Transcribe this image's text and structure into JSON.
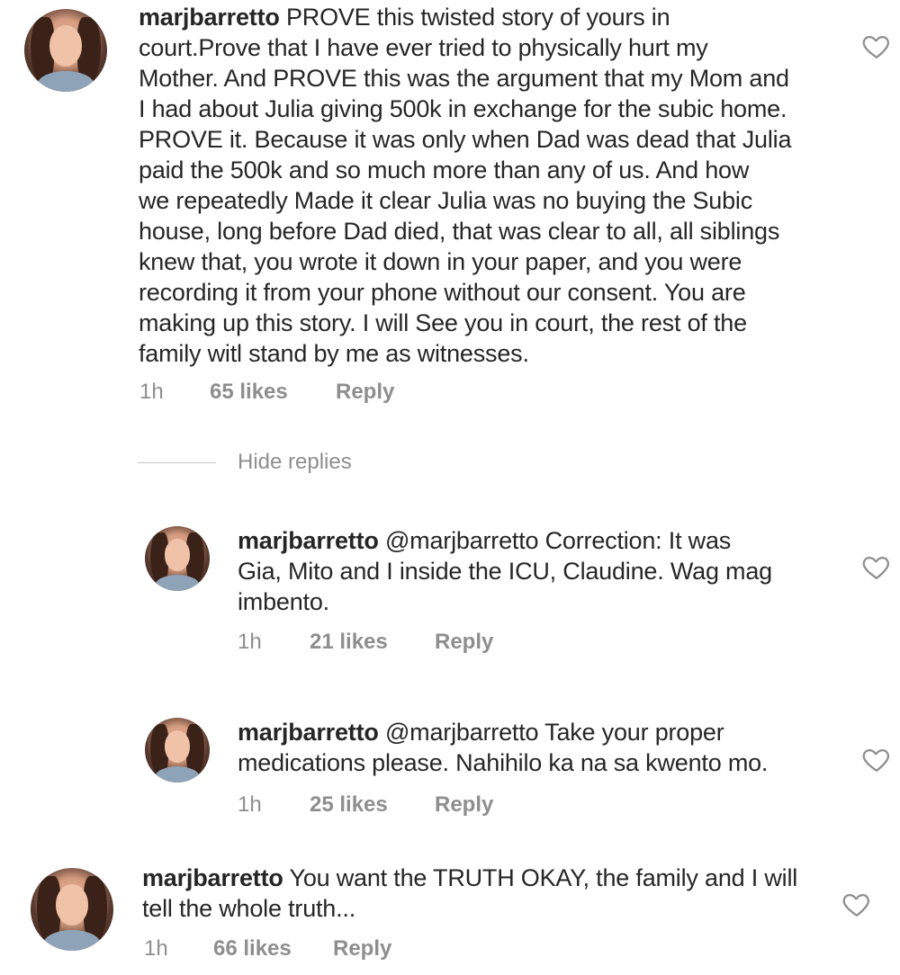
{
  "comments": [
    {
      "username": "marjbarretto",
      "lines": [
        "PROVE this twisted story of yours in",
        "court.Prove that I have ever tried to physically hurt my",
        "Mother. And PROVE this was the argument that my Mom and",
        "I had about Julia giving 500k in exchange for the subic home.",
        "PROVE it. Because it was only when Dad was dead that Julia",
        "paid the 500k and so much more than any of us. And how",
        "we repeatedly Made it clear Julia was no buying the Subic",
        "house, long before Dad died, that was clear to all, all siblings",
        "knew that, you wrote it down in your paper, and you were",
        "recording it from your phone without our consent. You are",
        "making up this story. I will See you in court, the rest of the",
        "family witl stand by me as witnesses."
      ],
      "time": "1h",
      "likes": "65 likes",
      "reply": "Reply"
    },
    {
      "username": "marjbarretto",
      "lines": [
        "@marjbarretto Correction: It was",
        "Gia, Mito and I inside the ICU, Claudine. Wag mag",
        "imbento."
      ],
      "time": "1h",
      "likes": "21 likes",
      "reply": "Reply"
    },
    {
      "username": "marjbarretto",
      "lines": [
        "@marjbarretto Take your proper",
        "medications please. Nahihilo ka na sa kwento mo."
      ],
      "time": "1h",
      "likes": "25 likes",
      "reply": "Reply"
    },
    {
      "username": "marjbarretto",
      "lines": [
        "You want the TRUTH OKAY, the family and I will",
        "tell the whole truth..."
      ],
      "time": "1h",
      "likes": "66 likes",
      "reply": "Reply"
    }
  ],
  "hide_replies": "Hide replies",
  "icons": {
    "like": "heart-outline-icon"
  }
}
